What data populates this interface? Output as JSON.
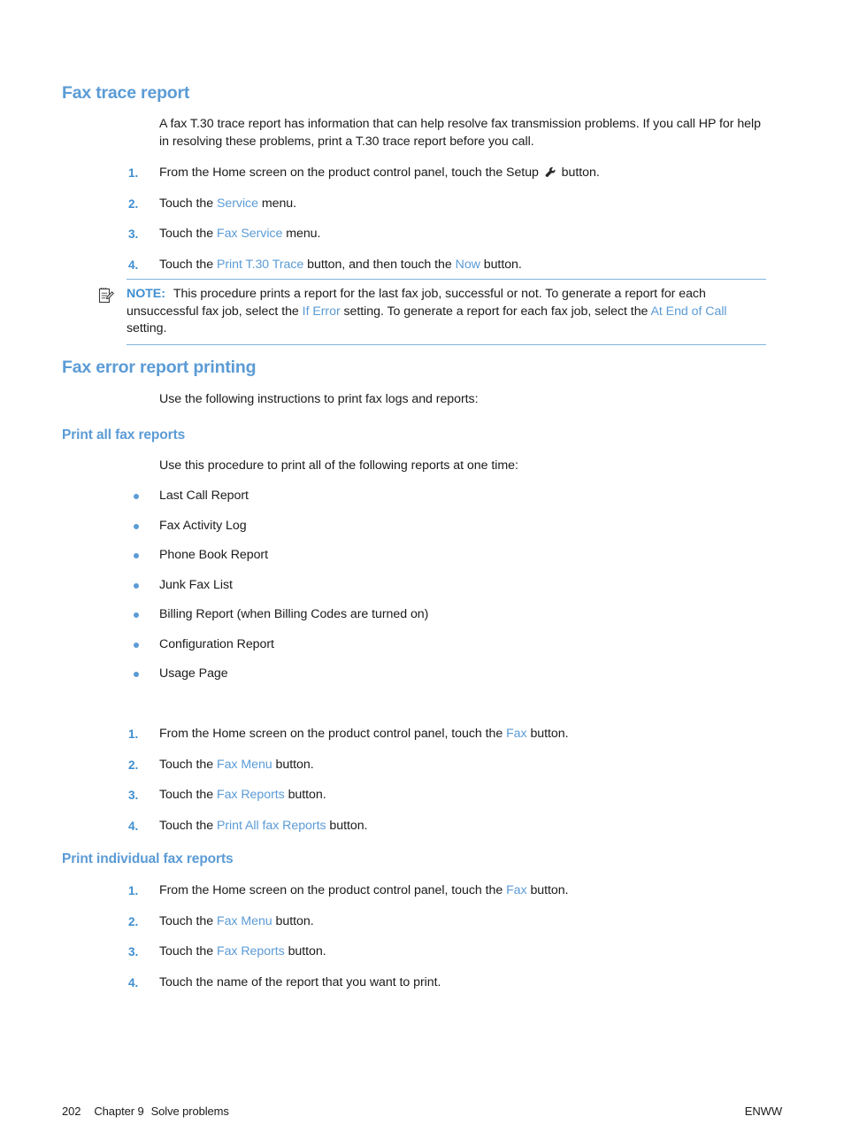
{
  "sections": [
    {
      "heading": "Fax trace report",
      "paragraph": "A fax T.30 trace report has information that can help resolve fax transmission problems. If you call HP for help in resolving these problems, print a T.30 trace report before you call.",
      "steps": [
        {
          "num": "1.",
          "pre": "From the Home screen on the product control panel, touch the Setup ",
          "icon": "wrench-icon",
          "post": " button."
        },
        {
          "num": "2.",
          "pre": "Touch the ",
          "link": "Service",
          "post": " menu."
        },
        {
          "num": "3.",
          "pre": "Touch the ",
          "link": "Fax Service",
          "post": " menu."
        },
        {
          "num": "4.",
          "pre": "Touch the ",
          "link": "Print T.30 Trace",
          "mid": " button, and then touch the ",
          "link2": "Now",
          "post": " button."
        }
      ]
    },
    {
      "heading": "Fax error report printing",
      "paragraph": "Use the following instructions to print fax logs and reports:"
    }
  ],
  "note": {
    "icon": "note-pencil-icon",
    "label": "NOTE:",
    "text_1": "This procedure prints a report for the last fax job, successful or not. To generate a report for each unsuccessful fax job, select the ",
    "link_1": "If Error",
    "text_2": " setting. To generate a report for each fax job, select the ",
    "link_2": "At End of Call",
    "text_3": " setting."
  },
  "subsections": [
    {
      "heading": "Print all fax reports",
      "paragraph": "Use this procedure to print all of the following reports at one time:",
      "bullets": [
        "Last Call Report",
        "Fax Activity Log",
        "Phone Book Report",
        "Junk Fax List",
        "Billing Report (when Billing Codes are turned on)",
        "Configuration Report",
        "Usage Page"
      ],
      "steps": [
        {
          "num": "1.",
          "pre": "From the Home screen on the product control panel, touch the ",
          "link": "Fax",
          "post": " button."
        },
        {
          "num": "2.",
          "pre": "Touch the ",
          "link": "Fax Menu",
          "post": " button."
        },
        {
          "num": "3.",
          "pre": "Touch the ",
          "link": "Fax Reports",
          "post": " button."
        },
        {
          "num": "4.",
          "pre": "Touch the ",
          "link": "Print All fax Reports",
          "post": " button."
        }
      ]
    },
    {
      "heading": "Print individual fax reports",
      "steps": [
        {
          "num": "1.",
          "pre": "From the Home screen on the product control panel, touch the ",
          "link": "Fax",
          "post": " button."
        },
        {
          "num": "2.",
          "pre": "Touch the ",
          "link": "Fax Menu",
          "post": " button."
        },
        {
          "num": "3.",
          "pre": "Touch the ",
          "link": "Fax Reports",
          "post": " button."
        },
        {
          "num": "4.",
          "pre": "Touch the name of the report that you want to print.",
          "post": ""
        }
      ]
    }
  ],
  "footer": {
    "page_number": "202",
    "chapter": "Chapter 9",
    "chapter_title": "Solve problems",
    "locale": "ENWW"
  },
  "colors": {
    "accent": "#5b9bd5",
    "link": "#5b9bd5",
    "text": "#1b1b1b",
    "rule": "#7fb4de"
  }
}
